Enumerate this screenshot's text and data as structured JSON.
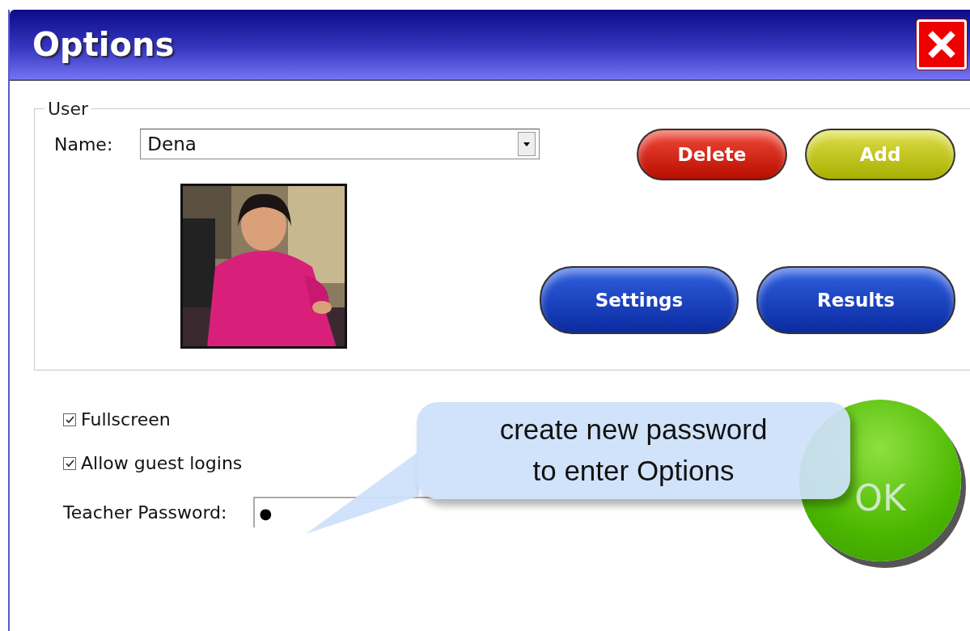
{
  "window": {
    "title": "Options"
  },
  "user_group": {
    "legend": "User",
    "name_label": "Name:",
    "name_value": "Dena",
    "buttons": [
      {
        "label": "Delete",
        "kind": "red"
      },
      {
        "label": "Add",
        "kind": "olive"
      },
      {
        "label": "Settings",
        "kind": "blue"
      },
      {
        "label": "Results",
        "kind": "blue"
      }
    ]
  },
  "checkboxes": [
    {
      "label": "Fullscreen",
      "checked": true
    },
    {
      "label": "Allow guest logins",
      "checked": true
    }
  ],
  "password": {
    "label": "Teacher Password:",
    "value": "●"
  },
  "ok_button": {
    "label": "OK"
  },
  "callout": {
    "text": "create new password\nto enter Options"
  }
}
